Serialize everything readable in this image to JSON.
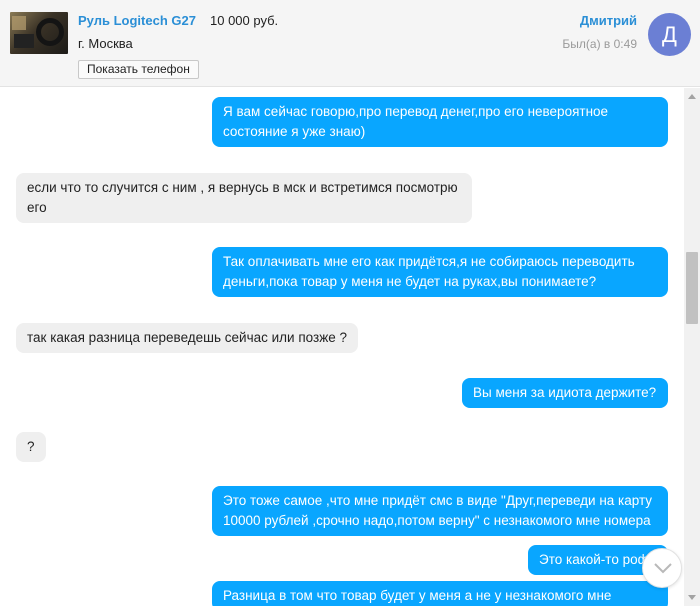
{
  "listing": {
    "title": "Руль Logitech G27",
    "price": "10 000 руб.",
    "city": "г. Москва",
    "show_phone_label": "Показать телефон"
  },
  "contact": {
    "name": "Дмитрий",
    "last_seen": "Был(а) в 0:49",
    "avatar_letter": "Д",
    "avatar_color": "#6b7fd4"
  },
  "colors": {
    "outgoing_bubble": "#09a6ff",
    "incoming_bubble": "#efefef",
    "link": "#2b8fd6"
  },
  "messages": [
    {
      "direction": "out",
      "lines": [
        "Я вам сейчас говорю,про перевод денег,про его невероятное",
        "состояние я уже знаю)"
      ]
    },
    {
      "direction": "in",
      "lines": [
        "если что то случится с ним , я вернусь в мск и встретимся посмотрю",
        "его"
      ]
    },
    {
      "direction": "out",
      "lines": [
        "Так оплачивать мне его как придётся,я не собираюсь переводить",
        "деньги,пока товар у меня не будет на руках,вы понимаете?"
      ]
    },
    {
      "direction": "in",
      "lines": [
        "так какая разница переведешь сейчас или позже ?"
      ]
    },
    {
      "direction": "out",
      "lines": [
        "Вы меня за идиота держите?"
      ]
    },
    {
      "direction": "in",
      "lines": [
        "?"
      ]
    },
    {
      "direction": "out",
      "lines": [
        "Это тоже самое ,что мне придёт смс в виде \"Друг,переведи на карту",
        "10000 рублей ,срочно надо,потом верну\" с незнакомого мне номера"
      ]
    },
    {
      "direction": "out",
      "lines": [
        "Это какой-то роф"
      ]
    },
    {
      "direction": "out",
      "lines": [
        "Разница в том что товар будет у меня а не у незнакомого мне"
      ]
    }
  ]
}
